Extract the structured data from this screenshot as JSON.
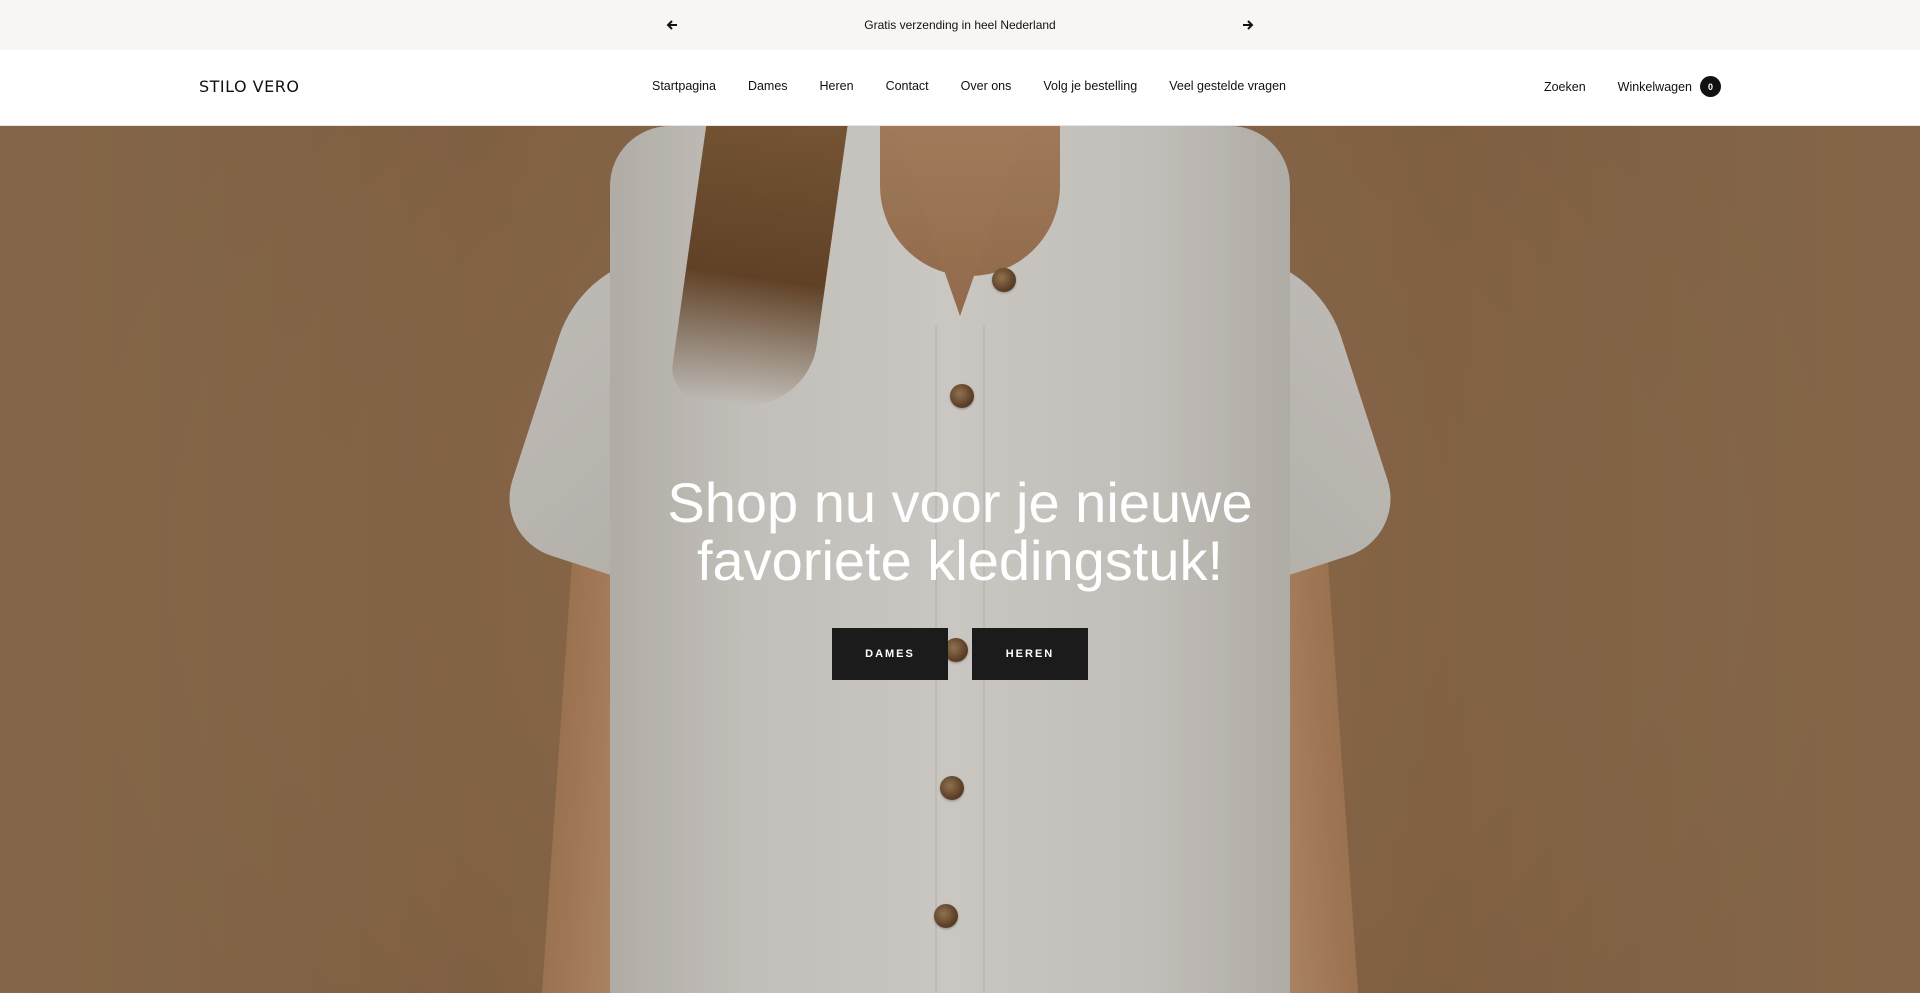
{
  "announcement": {
    "message": "Gratis verzending in heel Nederland",
    "prev_icon": "arrow-left-icon",
    "next_icon": "arrow-right-icon"
  },
  "header": {
    "logo": "STILO VERO",
    "nav": [
      {
        "label": "Startpagina"
      },
      {
        "label": "Dames"
      },
      {
        "label": "Heren"
      },
      {
        "label": "Contact"
      },
      {
        "label": "Over ons"
      },
      {
        "label": "Volg je bestelling"
      },
      {
        "label": "Veel gestelde vragen"
      }
    ],
    "search_label": "Zoeken",
    "cart_label": "Winkelwagen",
    "cart_count": "0"
  },
  "hero": {
    "title_line1": "Shop nu voor je nieuwe",
    "title_line2": "favoriete kledingstuk!",
    "button_women": "DAMES",
    "button_men": "HEREN"
  },
  "colors": {
    "announcement_bg": "#f8f6f4",
    "button_bg": "#1b1b1b",
    "hero_bg": "#a07a56"
  }
}
